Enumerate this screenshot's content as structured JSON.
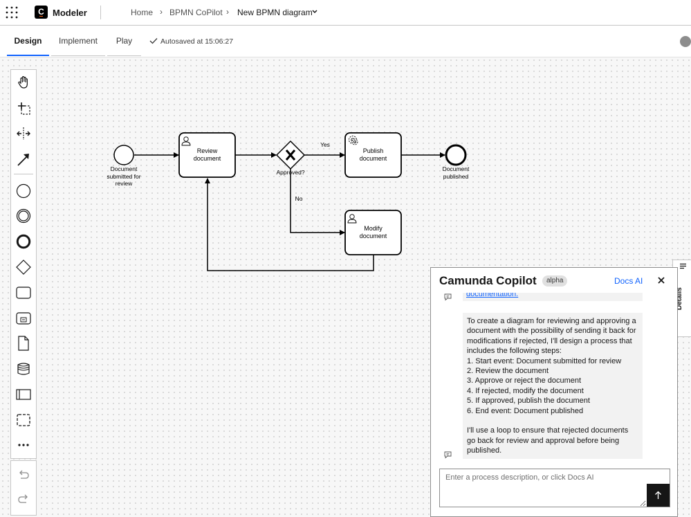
{
  "topbar": {
    "app_name": "Modeler",
    "logo_letter": "C",
    "breadcrumbs": [
      "Home",
      "BPMN CoPilot"
    ],
    "breadcrumb_sep": "›",
    "current_diagram": "New BPMN diagram"
  },
  "tabs": {
    "design": "Design",
    "implement": "Implement",
    "play": "Play",
    "autosave": "Autosaved at 15:06:27"
  },
  "palette": {
    "tools": [
      "hand-tool",
      "lasso-tool",
      "space-tool",
      "connect-tool",
      "start-event",
      "intermediate-event",
      "end-event",
      "gateway",
      "task",
      "subprocess",
      "data-object",
      "data-store",
      "pool",
      "group",
      "more-tools"
    ],
    "undo": "undo",
    "redo": "redo"
  },
  "diagram": {
    "start_event": "Document submitted for review",
    "review_task": "Review document",
    "gateway": "Approved?",
    "yes_label": "Yes",
    "no_label": "No",
    "publish_task": "Publish document",
    "modify_task": "Modify document",
    "end_event": "Document published"
  },
  "copilot": {
    "title": "Camunda Copilot",
    "badge": "alpha",
    "docs_ai": "Docs AI",
    "previous_link": "documentation.",
    "message_intro": "To create a diagram for reviewing and approving a document with the possibility of sending it back for modifications if rejected, I'll design a process that includes the following steps:",
    "steps": [
      "1. Start event: Document submitted for review",
      "2. Review the document",
      "3. Approve or reject the document",
      "4. If rejected, modify the document",
      "5. If approved, publish the document",
      "6. End event: Document published"
    ],
    "message_outro": "I'll use a loop to ensure that rejected documents go back for review and approval before being published.",
    "input_placeholder": "Enter a process description, or click Docs AI"
  },
  "details_tab": "Details",
  "colors": {
    "accent": "#0f62fe",
    "status_dot": "#8d8d8d"
  }
}
